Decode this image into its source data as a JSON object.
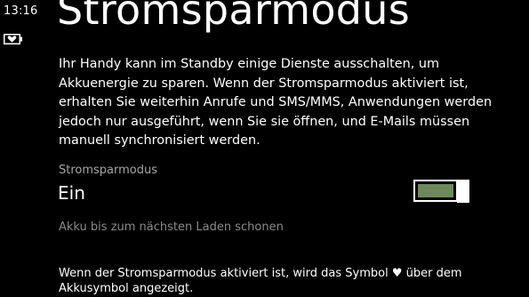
{
  "status_bar": {
    "time": "13:16",
    "battery_icon": "battery-saver-heart-icon"
  },
  "page": {
    "title": "Stromsparmodus",
    "description": "Ihr Handy kann im Standby einige Dienste ausschalten, um Akkuenergie zu sparen. Wenn der Stromsparmodus aktiviert ist, erhalten Sie weiterhin Anrufe und SMS/MMS, Anwendungen werden jedoch nur ausgeführt, wenn Sie sie öffnen, und E-Mails müssen manuell synchronisiert werden."
  },
  "toggle": {
    "header": "Stromsparmodus",
    "state_label": "Ein",
    "is_on": true,
    "accent_color": "#6d8b5a"
  },
  "option": {
    "label": "Akku bis zum nächsten Laden schonen"
  },
  "footer": {
    "text_before_icon": "Wenn der Stromsparmodus aktiviert ist, wird das Symbol",
    "icon": "heart-icon",
    "icon_glyph": "♥",
    "text_after_icon": "über dem Akkusymbol angezeigt."
  }
}
